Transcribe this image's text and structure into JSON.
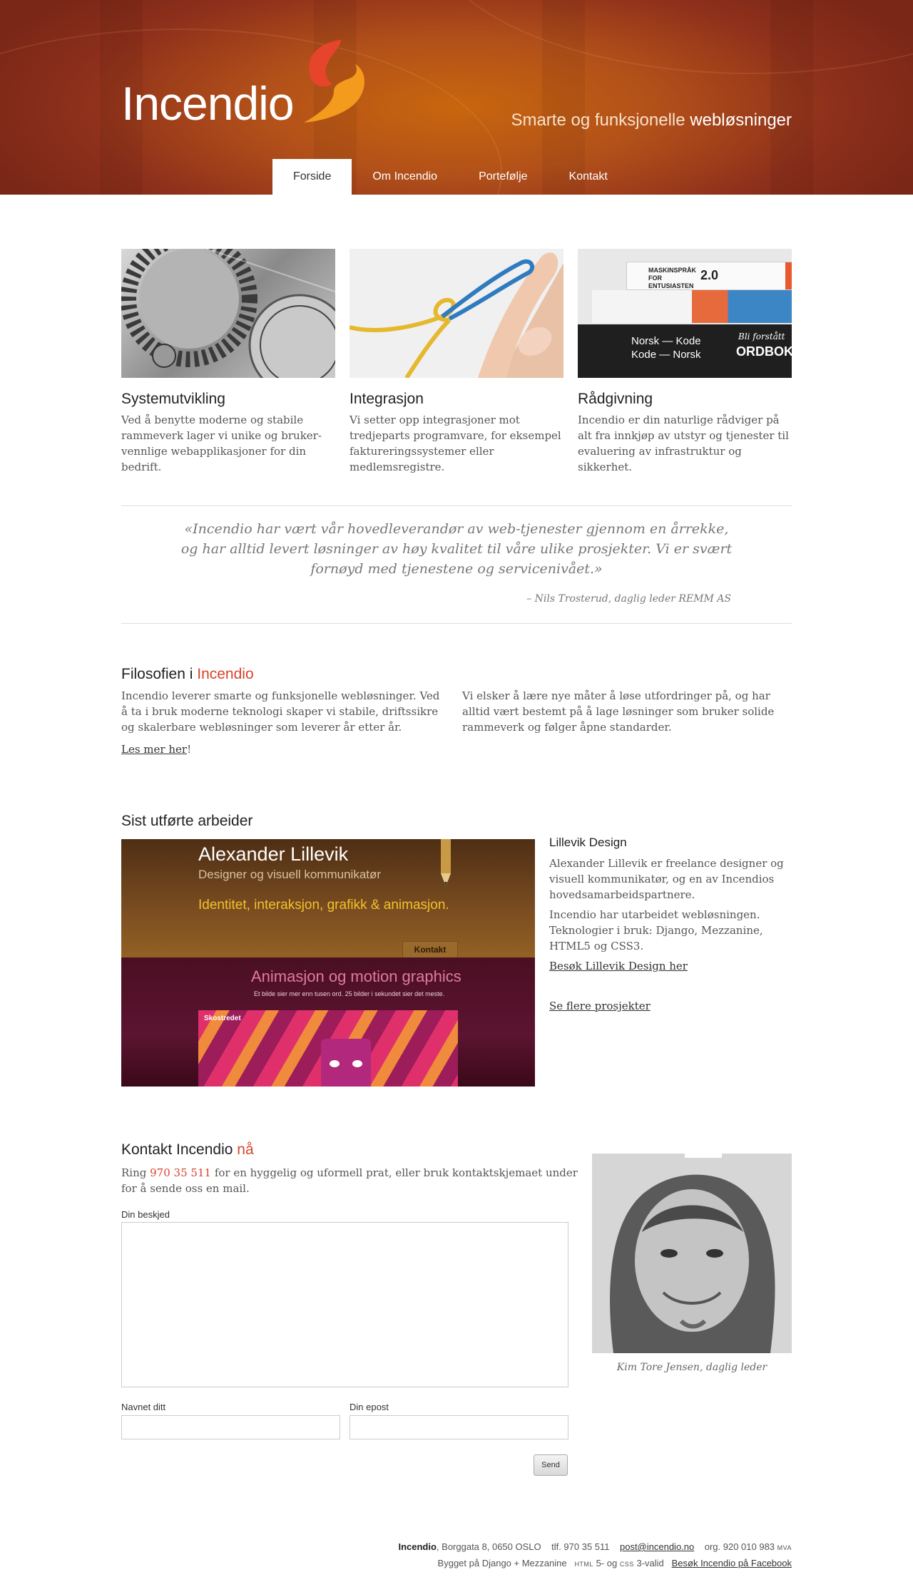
{
  "header": {
    "logo": "Incendio",
    "tagline_light": "Smarte og funksjonelle",
    "tagline_bold": "webløsninger",
    "nav": [
      {
        "label": "Forside"
      },
      {
        "label": "Om Incendio"
      },
      {
        "label": "Portefølje"
      },
      {
        "label": "Kontakt"
      }
    ]
  },
  "services": [
    {
      "title": "Systemutvikling",
      "text": "Ved å benytte moderne og stabile rammeverk lager vi unike og bruker-vennlige webapplikasjoner for din bedrift."
    },
    {
      "title": "Integrasjon",
      "text": "Vi setter opp integrasjoner mot tredjeparts programvare, for eksempel faktureringssystemer eller medlemsregistre."
    },
    {
      "title": "Rådgivning",
      "text": "Incendio er din naturlige rådviger på alt fra innkjøp av utstyr og tjenester til evaluering av infrastruktur og sikkerhet."
    }
  ],
  "book_titles": {
    "top": "MASKINSPRÅK FOR ENTUSIASTEN",
    "top_version": "2.0",
    "bottom_left": "Norsk — Kode\nKode — Norsk",
    "bottom_right_1": "Bli forstått",
    "bottom_right_2": "ORDBOK"
  },
  "quote": {
    "text": "«Incendio har vært vår hovedleverandør av web-tjenester gjennom en årrekke, og har alltid levert løsninger av høy kvalitet til våre ulike prosjekter. Vi er svært fornøyd med tjenestene og servicenivået.»",
    "author": "– Nils Trosterud, daglig leder REMM AS"
  },
  "philosophy": {
    "title_prefix": "Filosofien i",
    "title_accent": "Incendio",
    "col1": "Incendio leverer smarte og funksjonelle webløsninger. Ved å ta i bruk moderne teknologi skaper vi stabile, driftssikre og skalerbare webløsninger som leverer år etter år.",
    "read_more_link": "Les mer her",
    "read_more_suffix": "!",
    "col2": "Vi elsker å lære nye måter å løse utfordringer på, og har alltid vært bestemt på å lage løsninger som bruker solide rammeverk og følger åpne standarder."
  },
  "work": {
    "title": "Sist utførte arbeider",
    "shot": {
      "name": "Alexander Lillevik",
      "subtitle": "Designer og visuell kommunikatør",
      "tagline": "Identitet, interaksjon, grafikk & animasjon.",
      "button": "Kontakt",
      "anim_title": "Animasjon og motion graphics",
      "anim_sub": "Et bilde sier mer enn tusen ord. 25 bilder i sekundet sier det meste.",
      "video_label": "Skostredet"
    },
    "project_title": "Lillevik Design",
    "desc1": "Alexander Lillevik er freelance designer og visuell kommunikatør, og en av Incendios hovedsamarbeidspartnere.",
    "desc2": "Incendio har utarbeidet webløsningen. Teknologier i bruk: Django, Mezzanine, HTML5 og CSS3.",
    "visit_link": "Besøk Lillevik Design her",
    "more_link": "Se flere prosjekter"
  },
  "contact": {
    "title_prefix": "Kontakt Incendio",
    "title_accent": "nå",
    "intro_prefix": "Ring",
    "phone": "970 35 511",
    "intro_suffix": "for en hyggelig og uformell prat, eller bruk kontaktskjemaet under for å sende oss en mail.",
    "message_label": "Din beskjed",
    "name_label": "Navnet ditt",
    "email_label": "Din epost",
    "send": "Send",
    "caption": "Kim Tore Jensen, daglig leder"
  },
  "footer": {
    "company": "Incendio",
    "address": ", Borggata 8, 0650 OSLO",
    "phone": "tlf. 970 35 511",
    "email": "post@incendio.no",
    "org": "org. 920 010 983",
    "mva": "MVA",
    "built": "Bygget på Django + Mezzanine",
    "html": "HTML",
    "five_og": "5- og",
    "css": "CSS",
    "valid": "3-valid",
    "facebook": "Besøk Incendio på Facebook"
  },
  "colors": {
    "accent": "#d9442b",
    "header_dark": "#7a2718",
    "header_light": "#c8660e"
  }
}
